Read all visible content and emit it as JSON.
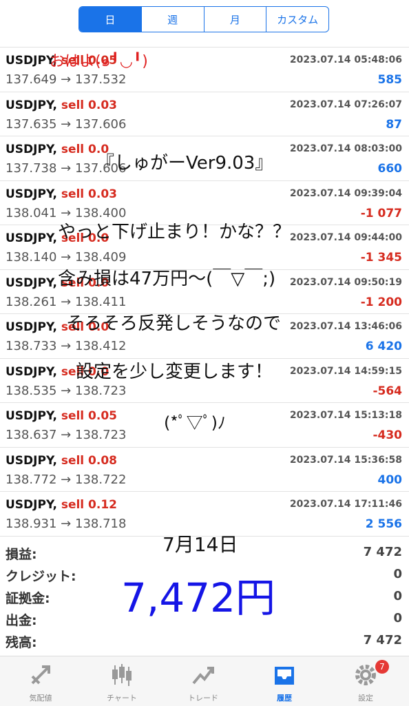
{
  "segments": [
    {
      "label": "日",
      "active": true
    },
    {
      "label": "週",
      "active": false
    },
    {
      "label": "月",
      "active": false
    },
    {
      "label": "カスタム",
      "active": false
    }
  ],
  "trades": [
    {
      "symbol": "USDJPY,",
      "side": "sell 0.05",
      "date": "2023.07.14 05:48:06",
      "open": "137.649",
      "close": "137.532",
      "profit": "585",
      "sign": "pos"
    },
    {
      "symbol": "USDJPY,",
      "side": "sell 0.03",
      "date": "2023.07.14 07:26:07",
      "open": "137.635",
      "close": "137.606",
      "profit": "87",
      "sign": "pos"
    },
    {
      "symbol": "USDJPY,",
      "side": "sell 0.0",
      "date": "2023.07.14 08:03:00",
      "open": "137.738",
      "close": "137.606",
      "profit": "660",
      "sign": "pos"
    },
    {
      "symbol": "USDJPY,",
      "side": "sell 0.03",
      "date": "2023.07.14 09:39:04",
      "open": "138.041",
      "close": "138.400",
      "profit": "-1 077",
      "sign": "neg"
    },
    {
      "symbol": "USDJPY,",
      "side": "sell 0.0",
      "date": "2023.07.14 09:44:00",
      "open": "138.140",
      "close": "138.409",
      "profit": "-1 345",
      "sign": "neg"
    },
    {
      "symbol": "USDJPY,",
      "side": "sell 0.0",
      "date": "2023.07.14 09:50:19",
      "open": "138.261",
      "close": "138.411",
      "profit": "-1 200",
      "sign": "neg"
    },
    {
      "symbol": "USDJPY,",
      "side": "sell 0.0",
      "date": "2023.07.14 13:46:06",
      "open": "138.733",
      "close": "138.412",
      "profit": "6 420",
      "sign": "pos"
    },
    {
      "symbol": "USDJPY,",
      "side": "sell 0.0",
      "date": "2023.07.14 14:59:15",
      "open": "138.535",
      "close": "138.723",
      "profit": "-564",
      "sign": "neg"
    },
    {
      "symbol": "USDJPY,",
      "side": "sell 0.05",
      "date": "2023.07.14 15:13:18",
      "open": "138.637",
      "close": "138.723",
      "profit": "-430",
      "sign": "neg"
    },
    {
      "symbol": "USDJPY,",
      "side": "sell 0.08",
      "date": "2023.07.14 15:36:58",
      "open": "138.772",
      "close": "138.722",
      "profit": "400",
      "sign": "pos"
    },
    {
      "symbol": "USDJPY,",
      "side": "sell 0.12",
      "date": "2023.07.14 17:11:46",
      "open": "138.931",
      "close": "138.718",
      "profit": "2 556",
      "sign": "pos"
    }
  ],
  "summary": [
    {
      "label": "損益:",
      "value": "7 472"
    },
    {
      "label": "クレジット:",
      "value": "0"
    },
    {
      "label": "証拠金:",
      "value": "0"
    },
    {
      "label": "出金:",
      "value": "0"
    },
    {
      "label": "残高:",
      "value": "7 472"
    }
  ],
  "tabs": [
    {
      "label": "気配値",
      "icon": "quotes-icon",
      "active": false
    },
    {
      "label": "チャート",
      "icon": "candlestick-chart-icon",
      "active": false
    },
    {
      "label": "トレード",
      "icon": "trade-icon",
      "active": false
    },
    {
      "label": "履歴",
      "icon": "history-inbox-icon",
      "active": true
    },
    {
      "label": "設定",
      "icon": "gear-icon",
      "active": false
    }
  ],
  "settings_badge": "7",
  "arrow": "→",
  "handwriting": {
    "line1": "おはよ(๑╹◡╹)",
    "line2": "『しゅがーVer9.03』",
    "line3": "やっと下げ止まり！かな？？",
    "line4": "含み損は47万円〜(￣▽￣;)",
    "line5": "そろそろ反発しそうなので",
    "line6": "設定を少し変更します！",
    "line7": "(*ﾟ▽ﾟ)ﾉ",
    "date": "7月14日",
    "total": "7,472円"
  },
  "colors": {
    "accent": "#1a73e8",
    "negative": "#d62b1f",
    "handwriting_red": "#e02020",
    "handwriting_blue": "#1515e6"
  }
}
